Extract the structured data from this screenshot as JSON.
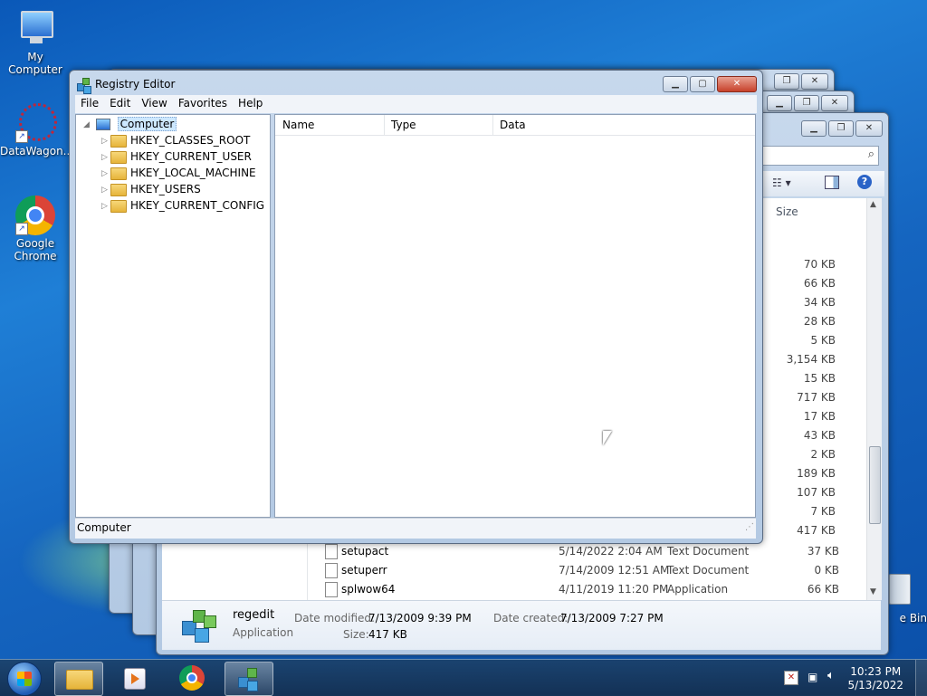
{
  "desktop": {
    "icons": [
      {
        "label": "My Computer"
      },
      {
        "label": "DataWagon..."
      },
      {
        "label": "Google Chrome"
      },
      {
        "label": "e Bin"
      }
    ]
  },
  "explorer": {
    "size_header": "Size",
    "sizes": [
      "70 KB",
      "66 KB",
      "34 KB",
      "28 KB",
      "5 KB",
      "3,154 KB",
      "15 KB",
      "717 KB",
      "17 KB",
      "43 KB",
      "2 KB",
      "189 KB",
      "107 KB",
      "7 KB",
      "417 KB"
    ],
    "files": [
      {
        "name": "setupact",
        "date": "5/14/2022 2:04 AM",
        "type": "Text Document",
        "size": "37 KB"
      },
      {
        "name": "setuperr",
        "date": "7/14/2009 12:51 AM",
        "type": "Text Document",
        "size": "0 KB"
      },
      {
        "name": "splwow64",
        "date": "4/11/2019 11:20 PM",
        "type": "Application",
        "size": "66 KB"
      }
    ],
    "details": {
      "name": "regedit",
      "kind": "Application",
      "modified_label": "Date modified:",
      "modified_value": "7/13/2009 9:39 PM",
      "created_label": "Date created:",
      "created_value": "7/13/2009 7:27 PM",
      "size_label": "Size:",
      "size_value": "417 KB"
    }
  },
  "regedit": {
    "title": "Registry Editor",
    "menu": [
      "File",
      "Edit",
      "View",
      "Favorites",
      "Help"
    ],
    "tree_root": "Computer",
    "hives": [
      "HKEY_CLASSES_ROOT",
      "HKEY_CURRENT_USER",
      "HKEY_LOCAL_MACHINE",
      "HKEY_USERS",
      "HKEY_CURRENT_CONFIG"
    ],
    "columns": [
      "Name",
      "Type",
      "Data"
    ],
    "status": "Computer"
  },
  "taskbar": {
    "time": "10:23 PM",
    "date": "5/13/2022"
  },
  "colors": {
    "selection": "#cde8ff",
    "accent": "#1565c0"
  }
}
